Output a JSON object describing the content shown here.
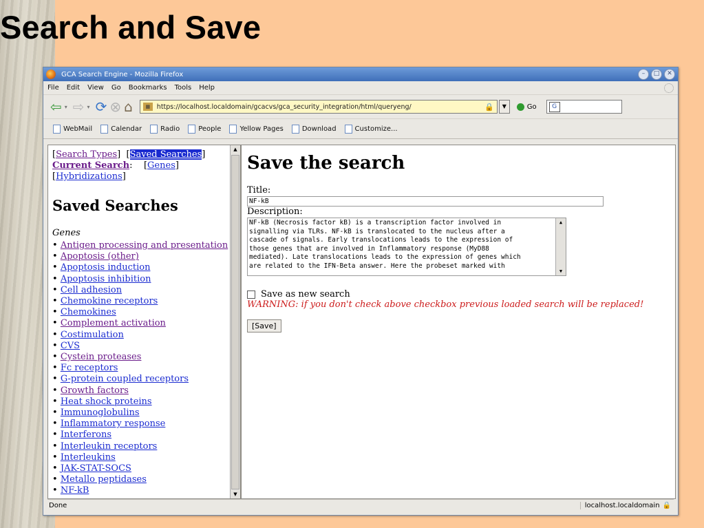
{
  "slide": {
    "title": "Search and Save"
  },
  "window": {
    "title": "GCA Search Engine - Mozilla Firefox",
    "controls": [
      "minimize-icon",
      "maximize-icon",
      "close-icon"
    ]
  },
  "menu": [
    "File",
    "Edit",
    "View",
    "Go",
    "Bookmarks",
    "Tools",
    "Help"
  ],
  "nav": {
    "url": "https://localhost.localdomain/gcacvs/gca_security_integration/html/queryeng/",
    "go_label": "Go"
  },
  "bookmarks": [
    "WebMail",
    "Calendar",
    "Radio",
    "People",
    "Yellow Pages",
    "Download",
    "Customize..."
  ],
  "left": {
    "links": {
      "search_types": "Search Types",
      "saved_searches": "Saved Searches",
      "current_search": "Current Search",
      "genes": "Genes",
      "hybridizations": "Hybridizations"
    },
    "heading": "Saved Searches",
    "category": "Genes",
    "items": [
      "Antigen processing and presentation",
      "Apoptosis (other)",
      "Apoptosis induction",
      "Apoptosis inhibition",
      "Cell adhesion",
      "Chemokine receptors",
      "Chemokines",
      "Complement activation",
      "Costimulation",
      "CVS",
      "Cystein proteases",
      "Fc receptors",
      "G-protein coupled receptors",
      "Growth factors",
      "Heat shock proteins",
      "Immunoglobulins",
      "Inflammatory response",
      "Interferons",
      "Interleukin receptors",
      "Interleukins",
      "JAK-STAT-SOCS",
      "Metallo peptidases",
      "NF-kB"
    ]
  },
  "right": {
    "heading": "Save the search",
    "title_label": "Title:",
    "title_value": "NF-kB",
    "desc_label": "Description:",
    "description": "NF-kB (Necrosis factor kB) is a transcription factor involved in\nsignalling via TLRs. NF-kB is translocated to the nucleus after a\ncascade of signals. Early translocations leads to the expression of\nthose genes that are involved in Inflammatory response (MyD88\nmediated). Late translocations leads to the expression of genes which\nare related to the IFN-Beta answer. Here the probeset marked with",
    "checkbox_label": "Save as new search",
    "warning": "WARNING: if you don't check above checkbox previous loaded search will be replaced!",
    "save_button": "[Save]"
  },
  "status": {
    "left": "Done",
    "right": "localhost.localdomain"
  }
}
